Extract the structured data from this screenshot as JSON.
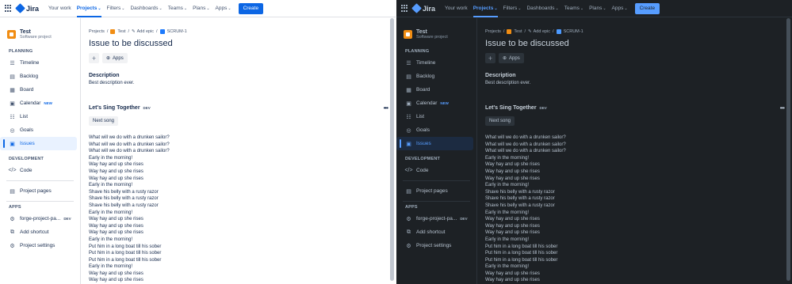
{
  "topnav": {
    "app_name": "Jira",
    "items": [
      "Your work",
      "Projects",
      "Filters",
      "Dashboards",
      "Teams",
      "Plans",
      "Apps"
    ],
    "active_index": 1,
    "create_label": "Create"
  },
  "project": {
    "name": "Test",
    "type": "Software project"
  },
  "sidebar": {
    "planning_header": "PLANNING",
    "planning": [
      {
        "label": "Timeline",
        "icon": "timeline-icon"
      },
      {
        "label": "Backlog",
        "icon": "backlog-icon"
      },
      {
        "label": "Board",
        "icon": "board-icon"
      },
      {
        "label": "Calendar",
        "icon": "calendar-icon",
        "badge": "NEW"
      },
      {
        "label": "List",
        "icon": "list-icon"
      },
      {
        "label": "Goals",
        "icon": "goals-icon"
      },
      {
        "label": "Issues",
        "icon": "issues-icon",
        "selected": true
      }
    ],
    "development_header": "DEVELOPMENT",
    "development": [
      {
        "label": "Code",
        "icon": "code-icon"
      }
    ],
    "project_pages": "Project pages",
    "apps_header": "APPS",
    "app_item": {
      "label": "forge-project-pa...",
      "badge": "DEV"
    },
    "add_shortcut": "Add shortcut",
    "project_settings": "Project settings"
  },
  "breadcrumb": {
    "projects": "Projects",
    "project": "Test",
    "epic": "Add epic",
    "issue": "SCRUM-1"
  },
  "issue": {
    "title": "Issue to be discussed",
    "apps_label": "Apps",
    "description_label": "Description",
    "description": "Best description ever."
  },
  "panel": {
    "title": "Let's Sing Together",
    "badge": "DEV",
    "next_button": "Next song",
    "lyrics": [
      "What will we do with a drunken sailor?",
      "What will we do with a drunken sailor?",
      "What will we do with a drunken sailor?",
      "Early in the morning!",
      "Way hay and up she rises",
      "Way hay and up she rises",
      "Way hay and up she rises",
      "Early in the morning!",
      "Shave his belly with a rusty razor",
      "Shave his belly with a rusty razor",
      "Shave his belly with a rusty razor",
      "Early in the morning!",
      "Way hay and up she rises",
      "Way hay and up she rises",
      "Way hay and up she rises",
      "Early in the morning!",
      "Put him in a long boat till his sober",
      "Put him in a long boat till his sober",
      "Put him in a long boat till his sober",
      "Early in the morning!",
      "Way hay and up she rises",
      "Way hay and up she rises"
    ]
  },
  "themes": {
    "light_primary": "#0c66e4",
    "dark_primary": "#579dff",
    "dark_bg": "#1d2125"
  }
}
